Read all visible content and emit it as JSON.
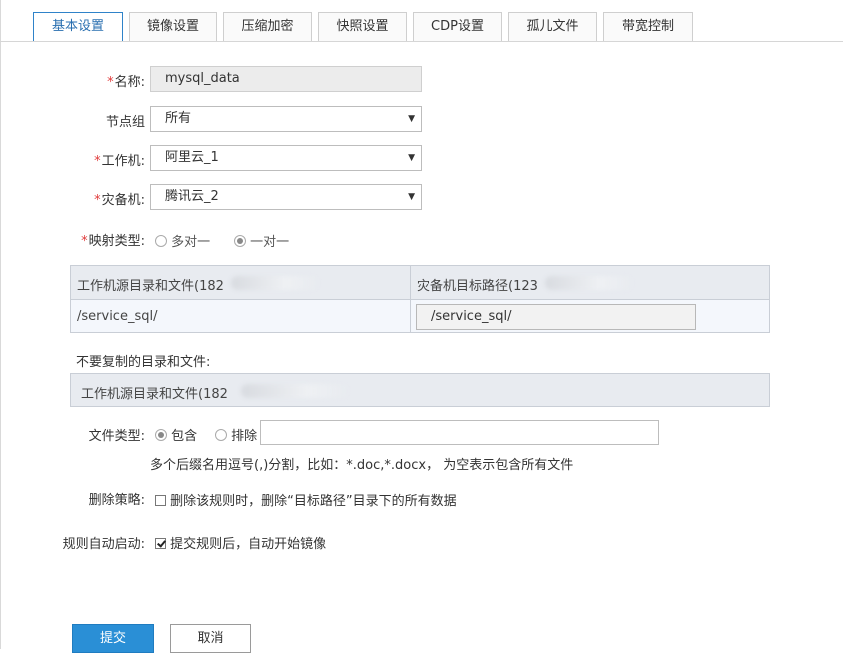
{
  "tabs": [
    {
      "label": "基本设置"
    },
    {
      "label": "镜像设置"
    },
    {
      "label": "压缩加密"
    },
    {
      "label": "快照设置"
    },
    {
      "label": "CDP设置"
    },
    {
      "label": "孤儿文件"
    },
    {
      "label": "带宽控制"
    }
  ],
  "form": {
    "required_mark": "*",
    "name_label": "名称:",
    "name_value": "mysql_data",
    "node_group_label": "节点组",
    "node_group_value": "所有",
    "worker_label": "工作机:",
    "worker_value": "阿里云_1",
    "backup_label": "灾备机:",
    "backup_value": "腾讯云_2",
    "mapping_type_label": "映射类型:",
    "mapping_options": [
      "多对一",
      "一对一"
    ],
    "mapping_selected": "一对一"
  },
  "mapping_table": {
    "source_header": "工作机源目录和文件(182",
    "target_header": "灾备机目标路径(123",
    "source_path": "/service_sql/",
    "target_path": "/service_sql/"
  },
  "exclude": {
    "title": "不要复制的目录和文件:",
    "header": "工作机源目录和文件(182"
  },
  "file_type": {
    "label": "文件类型:",
    "include_label": "包含",
    "exclude_label": "排除",
    "selected": "包含",
    "input_value": "",
    "hint": "多个后缀名用逗号(,)分割，比如：*.doc,*.docx， 为空表示包含所有文件"
  },
  "delete_policy": {
    "label": "删除策略:",
    "checkbox_label": "删除该规则时，删除“目标路径”目录下的所有数据",
    "checked": false
  },
  "auto_start": {
    "label": "规则自动启动:",
    "checkbox_label": "提交规则后，自动开始镜像",
    "checked": true
  },
  "buttons": {
    "submit": "提交",
    "cancel": "取消"
  },
  "colors": {
    "accent": "#2a8fd6",
    "required": "#e03a3a",
    "table_header_bg": "#e8ebf0"
  },
  "icons": {
    "select_caret": "▼"
  }
}
